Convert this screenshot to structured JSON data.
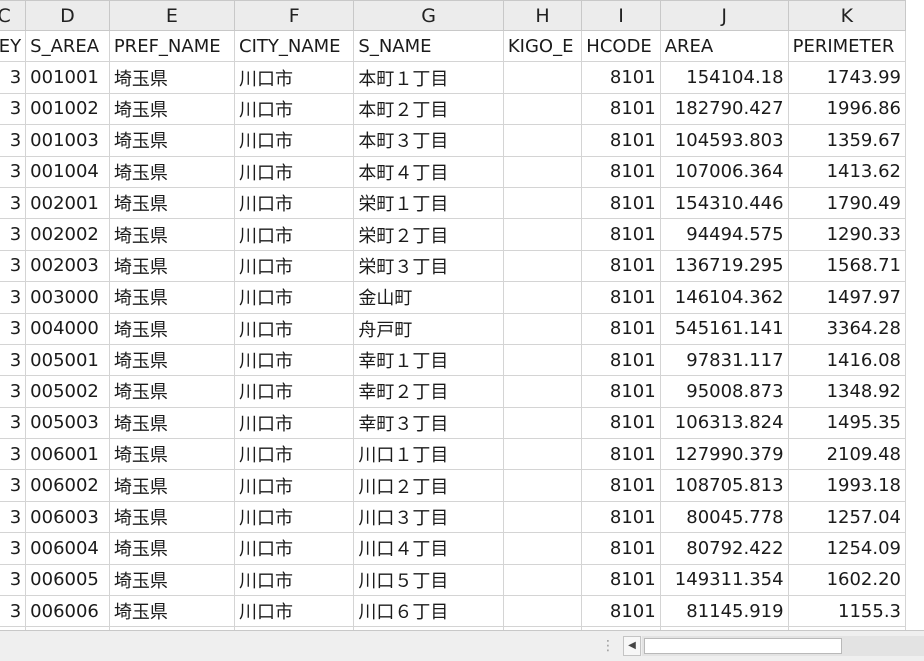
{
  "columns": [
    "C",
    "D",
    "E",
    "F",
    "G",
    "H",
    "I",
    "J",
    "K"
  ],
  "headers": [
    "KEY",
    "S_AREA",
    "PREF_NAME",
    "CITY_NAME",
    "S_NAME",
    "KIGO_E",
    "HCODE",
    "AREA",
    "PERIMETER"
  ],
  "rows": [
    [
      "3",
      "001001",
      "埼玉県",
      "川口市",
      "本町１丁目",
      "",
      "8101",
      "154104.18",
      "1743.99"
    ],
    [
      "3",
      "001002",
      "埼玉県",
      "川口市",
      "本町２丁目",
      "",
      "8101",
      "182790.427",
      "1996.86"
    ],
    [
      "3",
      "001003",
      "埼玉県",
      "川口市",
      "本町３丁目",
      "",
      "8101",
      "104593.803",
      "1359.67"
    ],
    [
      "3",
      "001004",
      "埼玉県",
      "川口市",
      "本町４丁目",
      "",
      "8101",
      "107006.364",
      "1413.62"
    ],
    [
      "3",
      "002001",
      "埼玉県",
      "川口市",
      "栄町１丁目",
      "",
      "8101",
      "154310.446",
      "1790.49"
    ],
    [
      "3",
      "002002",
      "埼玉県",
      "川口市",
      "栄町２丁目",
      "",
      "8101",
      "94494.575",
      "1290.33"
    ],
    [
      "3",
      "002003",
      "埼玉県",
      "川口市",
      "栄町３丁目",
      "",
      "8101",
      "136719.295",
      "1568.71"
    ],
    [
      "3",
      "003000",
      "埼玉県",
      "川口市",
      "金山町",
      "",
      "8101",
      "146104.362",
      "1497.97"
    ],
    [
      "3",
      "004000",
      "埼玉県",
      "川口市",
      "舟戸町",
      "",
      "8101",
      "545161.141",
      "3364.28"
    ],
    [
      "3",
      "005001",
      "埼玉県",
      "川口市",
      "幸町１丁目",
      "",
      "8101",
      "97831.117",
      "1416.08"
    ],
    [
      "3",
      "005002",
      "埼玉県",
      "川口市",
      "幸町２丁目",
      "",
      "8101",
      "95008.873",
      "1348.92"
    ],
    [
      "3",
      "005003",
      "埼玉県",
      "川口市",
      "幸町３丁目",
      "",
      "8101",
      "106313.824",
      "1495.35"
    ],
    [
      "3",
      "006001",
      "埼玉県",
      "川口市",
      "川口１丁目",
      "",
      "8101",
      "127990.379",
      "2109.48"
    ],
    [
      "3",
      "006002",
      "埼玉県",
      "川口市",
      "川口２丁目",
      "",
      "8101",
      "108705.813",
      "1993.18"
    ],
    [
      "3",
      "006003",
      "埼玉県",
      "川口市",
      "川口３丁目",
      "",
      "8101",
      "80045.778",
      "1257.04"
    ],
    [
      "3",
      "006004",
      "埼玉県",
      "川口市",
      "川口４丁目",
      "",
      "8101",
      "80792.422",
      "1254.09"
    ],
    [
      "3",
      "006005",
      "埼玉県",
      "川口市",
      "川口５丁目",
      "",
      "8101",
      "149311.354",
      "1602.20"
    ],
    [
      "3",
      "006006",
      "埼玉県",
      "川口市",
      "川口６丁目",
      "",
      "8101",
      "81145.919",
      "1155.3"
    ],
    [
      "",
      "",
      "",
      "",
      "",
      "",
      "",
      "",
      ""
    ]
  ],
  "statusbar": {
    "split_handle_icon": "vertical-dots-icon",
    "scroll_left_icon": "triangle-left-icon",
    "scroll_left_glyph": "◀",
    "split_glyph": "⋮"
  }
}
